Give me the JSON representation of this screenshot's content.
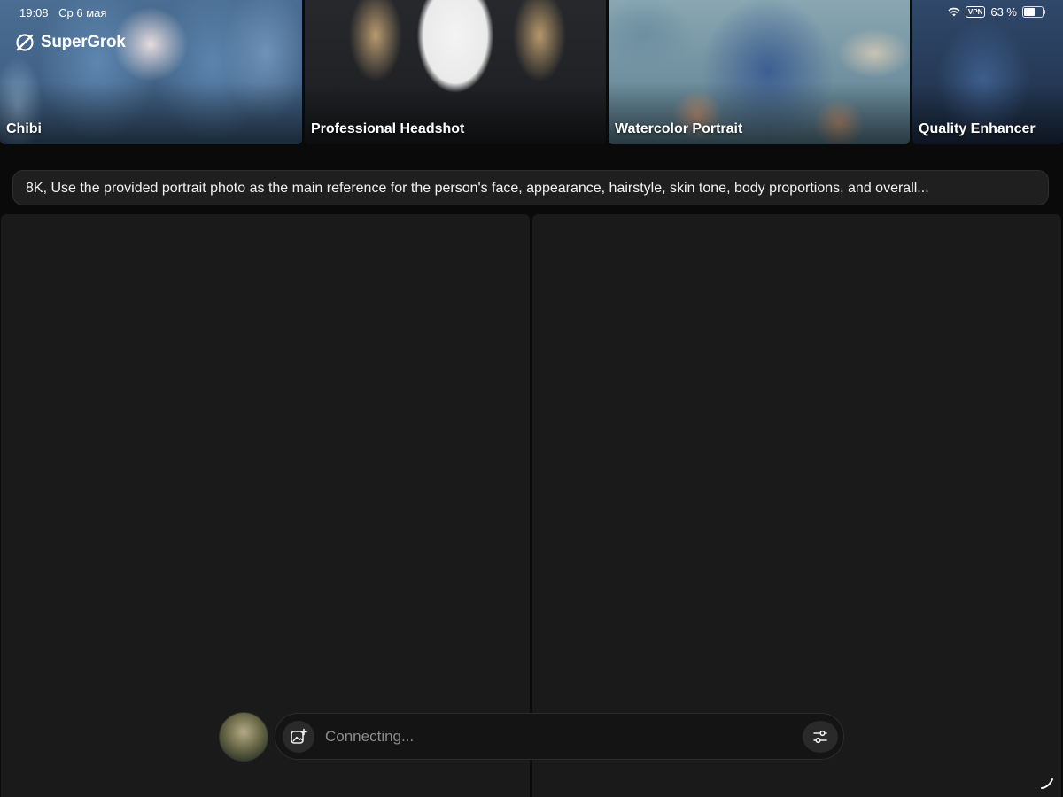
{
  "status_bar": {
    "time": "19:08",
    "date": "Ср 6 мая",
    "vpn": "VPN",
    "battery": "63 %"
  },
  "brand": {
    "name": "SuperGrok",
    "icon": "grok-logo-icon"
  },
  "templates": [
    {
      "label": "Chibi"
    },
    {
      "label": "Professional Headshot"
    },
    {
      "label": "Watercolor Portrait"
    },
    {
      "label": "Quality Enhancer"
    }
  ],
  "prompt": {
    "text": "8K, Use the provided portrait photo as the main reference for the person's face, appearance, hairstyle, skin tone, body proportions, and overall..."
  },
  "composer": {
    "status_text": "Connecting...",
    "attach_icon": "image-plus-icon",
    "settings_icon": "sliders-icon"
  }
}
